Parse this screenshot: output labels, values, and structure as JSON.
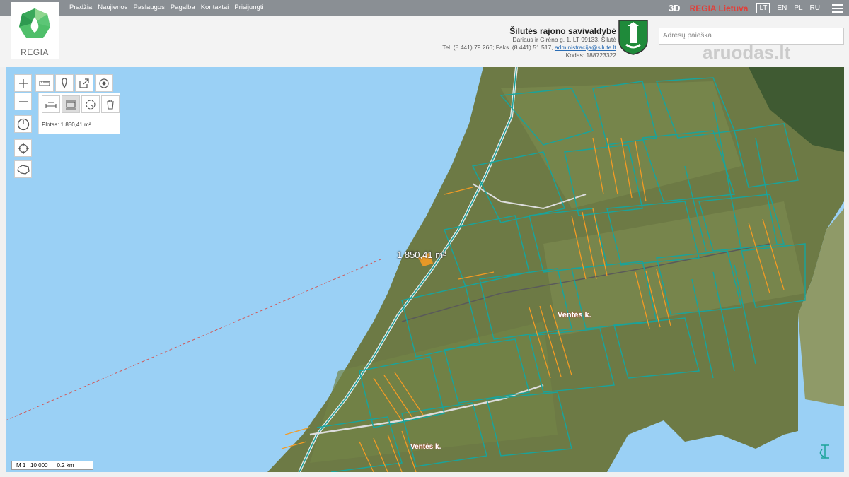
{
  "topnav": {
    "items": [
      "Pradžia",
      "Naujienos",
      "Paslaugos",
      "Pagalba",
      "Kontaktai",
      "Prisijungti"
    ],
    "btn_3d": "3D",
    "regia_lietuva": "REGIA Lietuva",
    "languages": [
      "LT",
      "EN",
      "PL",
      "RU"
    ],
    "active_language": "LT"
  },
  "header": {
    "logo_text": "REGIA",
    "municipality_name": "Šilutės rajono savivaldybė",
    "address": "Dariaus ir Girėno g. 1, LT 99133, Šilutė",
    "contacts_prefix": "Tel. (8 441) 79 266; Faks. (8 441) 51 517, ",
    "email": "administracija@silute.lt",
    "code": "Kodas: 188723322",
    "search_placeholder": "Adresų paieška",
    "watermark": "aruodas.lt"
  },
  "map": {
    "measurement_panel_text": "Plotas: 1 850,41 m²",
    "area_label": "1 850,41 m²",
    "place_label_1": "Ventės k.",
    "place_label_2": "Ventės k.",
    "scale_ratio": "M 1 : 10 000",
    "scale_distance": "0.2 km"
  },
  "colors": {
    "water": "#9ad0f5",
    "land": "#6d7a45",
    "parcel_outline": "#1aa39a",
    "parcel_orange": "#f39b24",
    "topbar": "#8a8f94",
    "brand_red": "#e0403a"
  },
  "icons": [
    "zoom-in-icon",
    "zoom-out-icon",
    "measure-length-icon",
    "marker-icon",
    "share-icon",
    "target-icon",
    "measure-distance-icon",
    "measure-area-icon",
    "radius-icon",
    "trash-icon",
    "compass-icon",
    "locate-icon",
    "lithuania-map-icon",
    "menu-icon",
    "search-icon"
  ]
}
